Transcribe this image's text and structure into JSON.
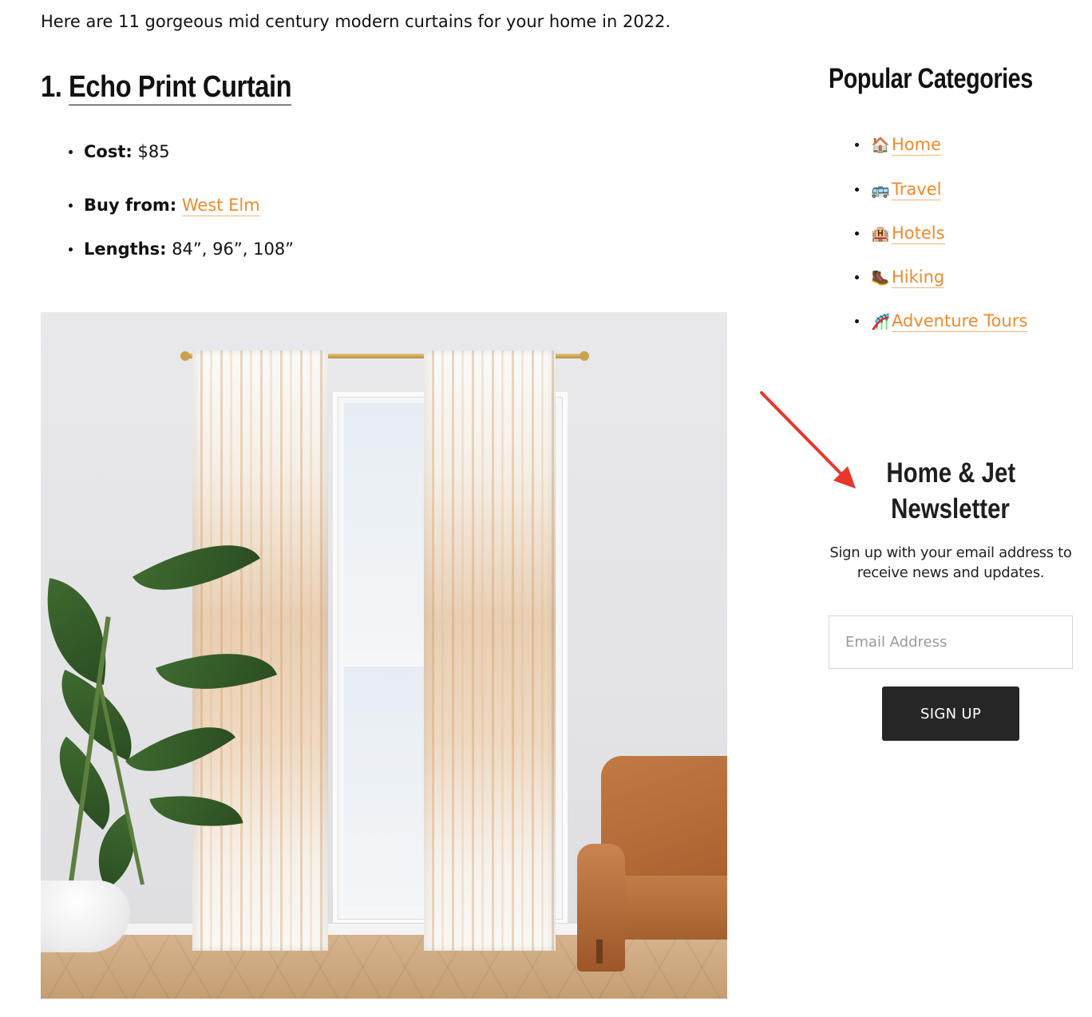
{
  "article": {
    "intro": "Here are 11 gorgeous mid century modern curtains for your home in 2022.",
    "product": {
      "number": "1.",
      "name": "Echo Print Curtain",
      "specs": {
        "cost_label": "Cost:",
        "cost_value": "$85",
        "buy_label": "Buy from:",
        "buy_link": "West Elm",
        "lengths_label": "Lengths:",
        "lengths_value": "84”, 96”, 108”"
      }
    }
  },
  "sidebar": {
    "heading": "Popular Categories",
    "categories": [
      {
        "icon": "house-icon",
        "emoji": "🏠",
        "label": "Home"
      },
      {
        "icon": "bus-icon",
        "emoji": "🚌",
        "label": "Travel"
      },
      {
        "icon": "hotel-icon",
        "emoji": "🏨",
        "label": "Hotels"
      },
      {
        "icon": "hiking-boot-icon",
        "emoji": "🥾",
        "label": "Hiking"
      },
      {
        "icon": "roller-coaster-icon",
        "emoji": "🎢",
        "label": "Adventure Tours"
      }
    ],
    "newsletter": {
      "title_line1": "Home & Jet",
      "title_line2": "Newsletter",
      "description": "Sign up with your email address to receive news and updates.",
      "email_placeholder": "Email Address",
      "button_label": "SIGN UP"
    }
  },
  "colors": {
    "link": "#f08a2b",
    "button_bg": "#262626",
    "annotation_arrow": "#e8372a"
  }
}
